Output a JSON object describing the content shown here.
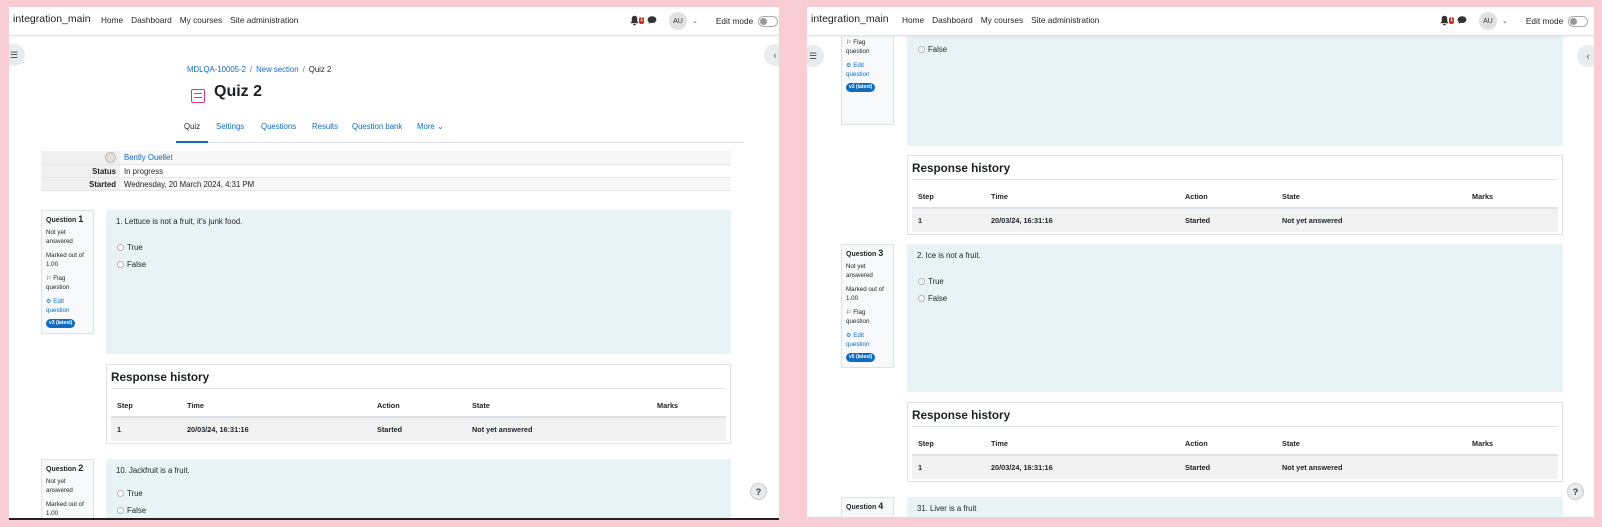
{
  "navbar": {
    "brand": "integration_main",
    "links": [
      "Home",
      "Dashboard",
      "My courses",
      "Site administration"
    ],
    "notif_count": "1",
    "avatar": "AU",
    "edit_mode": "Edit mode"
  },
  "breadcrumb": [
    "MDLQA-10005-2",
    "New section",
    "Quiz 2"
  ],
  "page_title": "Quiz 2",
  "tabs": [
    "Quiz",
    "Settings",
    "Questions",
    "Results",
    "Question bank",
    "More"
  ],
  "summary": {
    "user": "Bently Ouellet",
    "status_label": "Status",
    "status_value": "In progress",
    "started_label": "Started",
    "started_value": "Wednesday, 20 March 2024, 4:31 PM"
  },
  "question_word": "Question",
  "info": {
    "state": "Not yet answered",
    "marked": "Marked out of 1.00",
    "flag": "Flag question",
    "edit": "Edit question"
  },
  "options": [
    "True",
    "False"
  ],
  "questions": [
    {
      "number": "1",
      "text": "1. Lettuce is not a fruit, it's junk food.",
      "version": "v3 (latest)"
    },
    {
      "number": "2",
      "text": "10. Jackfruit is a fruit.",
      "version": "v3 (latest)"
    },
    {
      "number": "3",
      "text": "2. Ice is not a fruit.",
      "version": "v5 (latest)"
    },
    {
      "number": "4",
      "text": "31. Liver is a fruit",
      "version": ""
    }
  ],
  "history": {
    "title": "Response history",
    "headers": [
      "Step",
      "Time",
      "Action",
      "State",
      "Marks"
    ],
    "row": [
      "1",
      "20/03/24, 16:31:16",
      "Started",
      "Not yet answered",
      ""
    ]
  },
  "help": "?"
}
